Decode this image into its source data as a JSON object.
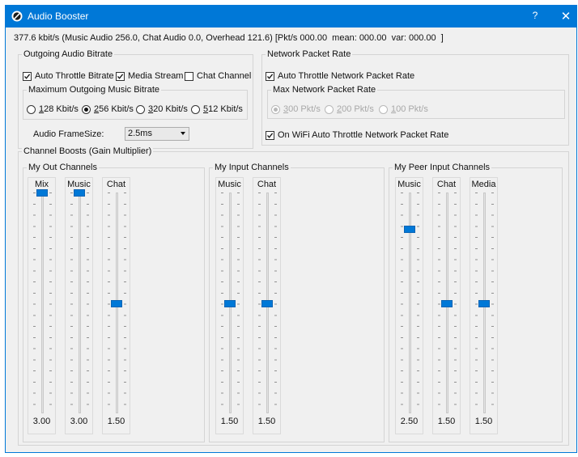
{
  "window": {
    "title": "Audio Booster",
    "help": "?",
    "close": "✕"
  },
  "status": "377.6 kbit/s (Music Audio 256.0, Chat Audio 0.0, Overhead 121.6) [Pkt/s 000.00  mean: 000.00  var: 000.00  ]",
  "bitrate": {
    "legend": "Outgoing Audio Bitrate",
    "auto_throttle": {
      "label": "Auto Throttle Bitrate",
      "checked": true
    },
    "media_stream": {
      "label": "Media Stream",
      "checked": true
    },
    "chat_channel": {
      "label": "Chat Channel",
      "checked": false
    },
    "max_legend": "Maximum Outgoing Music Bitrate",
    "options": [
      {
        "key": "1",
        "rest": "28 Kbit/s",
        "selected": false
      },
      {
        "key": "2",
        "rest": "56 Kbit/s",
        "selected": true
      },
      {
        "key": "3",
        "rest": "20 Kbit/s",
        "selected": false
      },
      {
        "key": "5",
        "rest": "12 Kbit/s",
        "selected": false
      }
    ],
    "framesize_label": "Audio FrameSize:",
    "framesize_value": "2.5ms"
  },
  "packet": {
    "legend": "Network Packet Rate",
    "auto_throttle": {
      "label": "Auto Throttle Network Packet Rate",
      "checked": true
    },
    "max_legend": "Max Network Packet Rate",
    "options": [
      {
        "key": "3",
        "rest": "00 Pkt/s",
        "selected": true
      },
      {
        "key": "2",
        "rest": "00 Pkt/s",
        "selected": false
      },
      {
        "key": "1",
        "rest": "00 Pkt/s",
        "selected": false
      }
    ],
    "wifi": {
      "label": "On WiFi Auto Throttle Network Packet Rate",
      "checked": true
    }
  },
  "boosts": {
    "legend": "Channel Boosts (Gain Multiplier)",
    "groups": [
      {
        "legend": "My Out Channels",
        "sliders": [
          {
            "label": "Mix",
            "value": "3.00",
            "level": 1.0
          },
          {
            "label": "Music",
            "value": "3.00",
            "level": 1.0
          },
          {
            "label": "Chat",
            "value": "1.50",
            "level": 0.5
          }
        ]
      },
      {
        "legend": "My Input Channels",
        "sliders": [
          {
            "label": "Music",
            "value": "1.50",
            "level": 0.5
          },
          {
            "label": "Chat",
            "value": "1.50",
            "level": 0.5
          }
        ]
      },
      {
        "legend": "My Peer Input Channels",
        "sliders": [
          {
            "label": "Music",
            "value": "2.50",
            "level": 0.8333
          },
          {
            "label": "Chat",
            "value": "1.50",
            "level": 0.5
          },
          {
            "label": "Media",
            "value": "1.50",
            "level": 0.5
          }
        ]
      }
    ]
  },
  "colors": {
    "accent": "#0078d7",
    "titlebar_text": "#ffffff",
    "window_bg": "#f0f0f0"
  }
}
